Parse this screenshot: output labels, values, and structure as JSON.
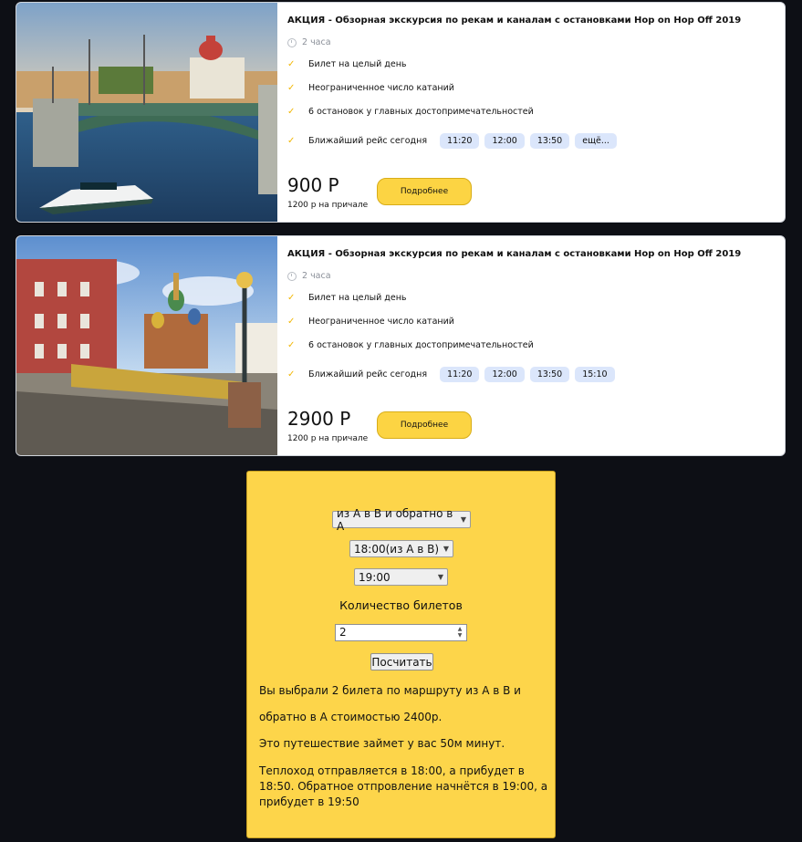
{
  "tours": [
    {
      "title": "АКЦИЯ - Обзорная экскурсия по рекам и каналам с остановками Hop on Hop Off 2019",
      "duration": "2 часа",
      "features": [
        "Билет на целый день",
        "Неограниченное число катаний",
        "6 остановок у главных достопримечательностей"
      ],
      "nearest_label": "Ближайший рейс сегодня",
      "times": [
        "11:20",
        "12:00",
        "13:50",
        "ещё..."
      ],
      "price": "900 Р",
      "pier_price": "1200 р на причале",
      "button_label": "Подробнее"
    },
    {
      "title": "АКЦИЯ - Обзорная экскурсия по рекам и каналам с остановками Hop on Hop Off 2019",
      "duration": "2 часа",
      "features": [
        "Билет на целый день",
        "Неограниченное число катаний",
        "6 остановок у главных достопримечательностей"
      ],
      "nearest_label": "Ближайший рейс сегодня",
      "times": [
        "11:20",
        "12:00",
        "13:50",
        "15:10"
      ],
      "price": "2900 Р",
      "pier_price": "1200 р на причале",
      "button_label": "Подробнее"
    }
  ],
  "calculator": {
    "route_select": "из A в B и обратно в А",
    "departure_select": "18:00(из А в В)",
    "return_select": "19:00",
    "qty_label": "Количество билетов",
    "qty_value": "2",
    "calc_button": "Посчитать",
    "result": {
      "line1": "Вы выбрали 2 билета по маршруту из A в B и",
      "line2": "обратно в А стоимостью 2400р.",
      "line3": "Это путешествие займет у вас 50м минут.",
      "line4": "Теплоход отправляется в 18:00, а прибудет в 18:50. Обратное отпровление начнётся в 19:00, а прибудет в 19:50"
    }
  },
  "colors": {
    "accent": "#fcd443",
    "page_bg": "#0d0f15",
    "time_chip": "#dbe6fb",
    "check": "#f2b705"
  },
  "icons": {
    "check": "check-icon",
    "clock": "clock-icon",
    "select_arrow": "chevron-down-icon"
  }
}
